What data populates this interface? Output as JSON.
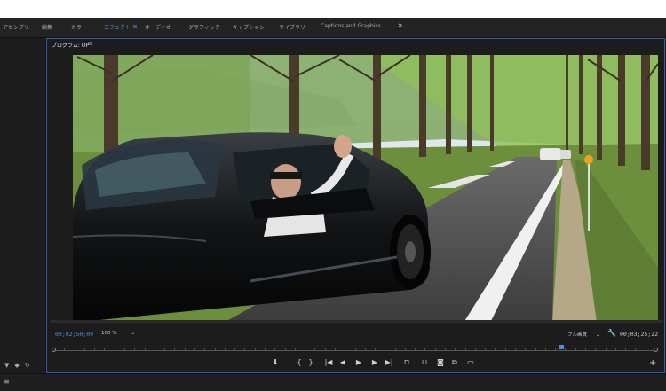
{
  "workspaces": [
    {
      "label": "アセンブリ",
      "active": false
    },
    {
      "label": "編集",
      "active": false
    },
    {
      "label": "カラー",
      "active": false
    },
    {
      "label": "エフェクト",
      "active": true
    },
    {
      "label": "オーディオ",
      "active": false
    },
    {
      "label": "グラフィック",
      "active": false
    },
    {
      "label": "キャプション",
      "active": false
    },
    {
      "label": "ライブラリ",
      "active": false
    },
    {
      "label": "Captions and Graphics",
      "active": false
    }
  ],
  "workspace_menu_icon": "hamburger-icon",
  "workspace_more_label": "»",
  "program_monitor": {
    "tab_label": "プログラム: OP",
    "current_timecode": "00;02;50;09",
    "zoom_label": "100 %",
    "resolution_label": "フル画質",
    "duration_timecode": "00;03;25;22",
    "playhead_fraction": 0.84
  },
  "transport_controls": [
    {
      "name": "add-marker",
      "glyph": "⬇"
    },
    {
      "name": "mark-in",
      "glyph": "{"
    },
    {
      "name": "mark-out",
      "glyph": "}"
    },
    {
      "name": "go-to-in",
      "glyph": "|◀"
    },
    {
      "name": "step-back",
      "glyph": "◀"
    },
    {
      "name": "play",
      "glyph": "▶"
    },
    {
      "name": "step-forward",
      "glyph": "▶"
    },
    {
      "name": "go-to-out",
      "glyph": "▶|"
    },
    {
      "name": "lift",
      "glyph": "⊓"
    },
    {
      "name": "extract",
      "glyph": "⊔"
    },
    {
      "name": "export-frame",
      "glyph": "◙"
    },
    {
      "name": "compare-view",
      "glyph": "⧉"
    },
    {
      "name": "safe-margins",
      "glyph": "▭"
    }
  ],
  "add_button_label": "+",
  "colors": {
    "accent": "#4a90e2",
    "panel_border": "#2d5fa8",
    "background": "#1a1a1a"
  }
}
